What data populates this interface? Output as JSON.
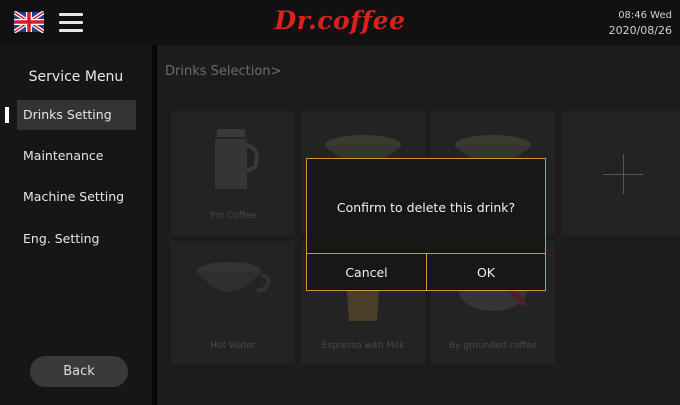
{
  "header": {
    "brand": "Dr.coffee",
    "time": "08:46 Wed",
    "date": "2020/08/26"
  },
  "sidebar": {
    "title": "Service Menu",
    "items": [
      {
        "label": "Drinks Setting",
        "active": true
      },
      {
        "label": "Maintenance"
      },
      {
        "label": "Machine Setting"
      },
      {
        "label": "Eng. Setting"
      }
    ],
    "back_label": "Back"
  },
  "main": {
    "breadcrumb": "Drinks Selection>",
    "tiles": [
      {
        "label": "Pot Coffee",
        "icon": "coffee-pot-icon"
      },
      {
        "label": "",
        "icon": "coffee-cup-icon"
      },
      {
        "label": "",
        "icon": "coffee-cup-icon"
      },
      {
        "label": "",
        "icon": "plus-icon"
      },
      {
        "label": "Hot Water",
        "icon": "water-cup-icon"
      },
      {
        "label": "Espresso with Milk",
        "icon": "latte-glass-icon"
      },
      {
        "label": "By grounded coffee",
        "icon": "coffee-scoop-icon"
      }
    ]
  },
  "dialog": {
    "message": "Confirm to delete this drink?",
    "cancel_label": "Cancel",
    "ok_label": "OK"
  },
  "colors": {
    "brand": "#d8221f",
    "dialog_border": "#c89a2e",
    "background": "#1b1b1b"
  }
}
